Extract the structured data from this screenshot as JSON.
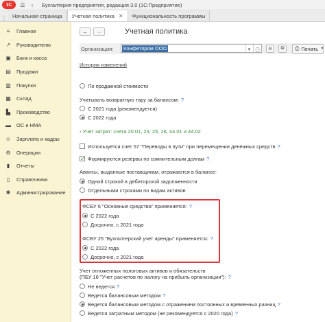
{
  "titlebar": {
    "logo": "1С",
    "app_title": "Бухгалтерия предприятия, редакция 3.0  (1С:Предприятие)"
  },
  "tabs": [
    {
      "label": "Начальная страница"
    },
    {
      "label": "Учетная политика"
    },
    {
      "label": "Функциональность программы"
    }
  ],
  "sidebar": {
    "items": [
      {
        "label": "Главное",
        "icon": "hamburger-icon"
      },
      {
        "label": "Руководителю",
        "icon": "chart-icon"
      },
      {
        "label": "Банк и касса",
        "icon": "bank-icon"
      },
      {
        "label": "Продажи",
        "icon": "cart-icon"
      },
      {
        "label": "Покупки",
        "icon": "basket-icon"
      },
      {
        "label": "Склад",
        "icon": "box-icon"
      },
      {
        "label": "Производство",
        "icon": "factory-icon"
      },
      {
        "label": "ОС и НМА",
        "icon": "car-icon"
      },
      {
        "label": "Зарплата и кадры",
        "icon": "people-icon"
      },
      {
        "label": "Операции",
        "icon": "gear-icon"
      },
      {
        "label": "Отчеты",
        "icon": "report-icon"
      },
      {
        "label": "Справочники",
        "icon": "book-icon"
      },
      {
        "label": "Администрирование",
        "icon": "settings-icon"
      }
    ]
  },
  "form": {
    "title": "Учетная политика",
    "org_label": "Организация:",
    "org_value": "Конфетпром ООО",
    "print_label": "Печать",
    "history_link": "История изменений",
    "by_sale_cost": "По продажной стоимости",
    "returnable_tare_label": "Учитывать возвратную тару за балансом:",
    "tare_option_2021": "С 2021 года (рекомендуется)",
    "tare_option_2022": "С 2022 года",
    "cost_accounts": "Учет затрат: счета 20.01, 23, 25, 26, 44.01 и 44.02",
    "account57": "Используется счет 57 \"Переводы в пути\" при перемещении денежных средств",
    "doubtful_debts": "Формируются резервы по сомнительным долгам",
    "advances_label": "Авансы, выданные поставщикам, отражаются в балансе:",
    "advances_opt1": "Одной строкой в дебиторской задолженности",
    "advances_opt2": "Отдельными строками по видам активов",
    "fsbu6_label": "ФСБУ 6 \"Основные средства\" применяется:",
    "fsbu6_opt1": "С 2022 года",
    "fsbu6_opt2": "Досрочно, с 2021 года",
    "fsbu25_label": "ФСБУ 25 \"Бухгалтерский учет аренды\" применяется:",
    "fsbu25_opt1": "С 2022 года",
    "fsbu25_opt2": "Досрочно, с 2021 года",
    "deferred_label_1": "Учет отложенных налоговых активов и обязательств",
    "deferred_label_2": "(ПБУ 18 \"Учет расчетов по налогу на прибыль организации\"):",
    "deferred_opt1": "Не ведется",
    "deferred_opt2": "Ведется балансовым методом",
    "deferred_opt3": "Ведется балансовым методом с отражением постоянных и временных разниц",
    "deferred_opt4": "Ведется затратным методом (не рекомендуется с 2020 года)",
    "help": "?"
  },
  "state": {
    "tare_selected": "С 2022 года",
    "doubtful_debts_checked": true,
    "account57_checked": false,
    "advances_selected": "Одной строкой в дебиторской задолженности",
    "fsbu6_selected": "С 2022 года",
    "fsbu25_selected": "С 2022 года",
    "deferred_selected": "Ведется балансовым методом с отражением постоянных и временных разниц"
  },
  "colors": {
    "sidebar_bg": "#fbf4d2",
    "highlight_border": "#d6373a",
    "org_selection": "#3a6ea5",
    "help_blue": "#3b78c3",
    "green_link": "#3a8a3a"
  }
}
